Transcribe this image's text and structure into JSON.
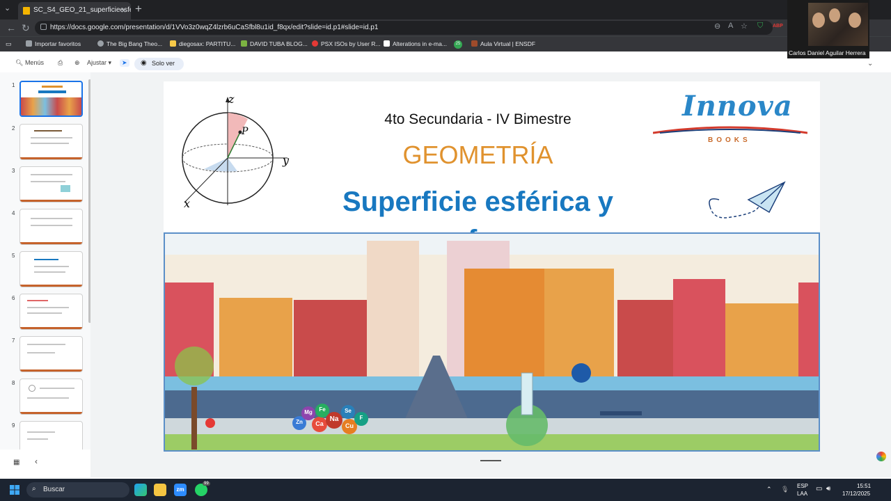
{
  "browser": {
    "tab_title": "SC_S4_GEO_21_superficieesferica...",
    "url": "https://docs.google.com/presentation/d/1VVo3z0wqZ4lzrb6uCaSfbl8u1id_f8qx/edit?slide=id.p1#slide=id.p1",
    "bookmarks": [
      {
        "label": "Importar favoritos",
        "color": "#9aa0a6"
      },
      {
        "label": "The Big Bang Theo...",
        "color": "#9aa0a6"
      },
      {
        "label": "diegosax: PARTITU...",
        "color": "#f7c948"
      },
      {
        "label": "DAVID TUBA BLOG...",
        "color": "#7cb342"
      },
      {
        "label": "PSX ISOs by User R...",
        "color": "#e53935"
      },
      {
        "label": "Alterations in e-ma...",
        "color": "#ffffff"
      },
      {
        "label": "25",
        "color": "#34a853"
      },
      {
        "label": "Aula Virtual | ENSDF",
        "color": "#9e4b2b"
      }
    ],
    "extension_badge": "ABP"
  },
  "video_call": {
    "participant_name": "Carlos Daniel Aguilar Herrera"
  },
  "toolbar": {
    "menus_label": "Menús",
    "fit_label": "Ajustar",
    "view_only_label": "Solo ver"
  },
  "thumbnails": [
    "1",
    "2",
    "3",
    "4",
    "5",
    "6",
    "7",
    "8",
    "9"
  ],
  "slide": {
    "subtitle": "4to Secundaria - IV Bimestre",
    "subject": "GEOMETRÍA",
    "topic_line1": "Superficie esférica y",
    "topic_line2": "esfera",
    "logo_text": "Innova",
    "logo_sub": "BOOKS",
    "axes": {
      "z": "z",
      "y": "y",
      "x": "x",
      "point": "P"
    },
    "elements": [
      "Zn",
      "Mg",
      "Ca",
      "Fe",
      "Na",
      "Se",
      "Cu",
      "F"
    ]
  },
  "taskbar": {
    "search_label": "Buscar",
    "lang_top": "ESP",
    "lang_bottom": "LAA",
    "time": "15:51",
    "date": "17/12/2025",
    "whatsapp_badge": "99"
  }
}
